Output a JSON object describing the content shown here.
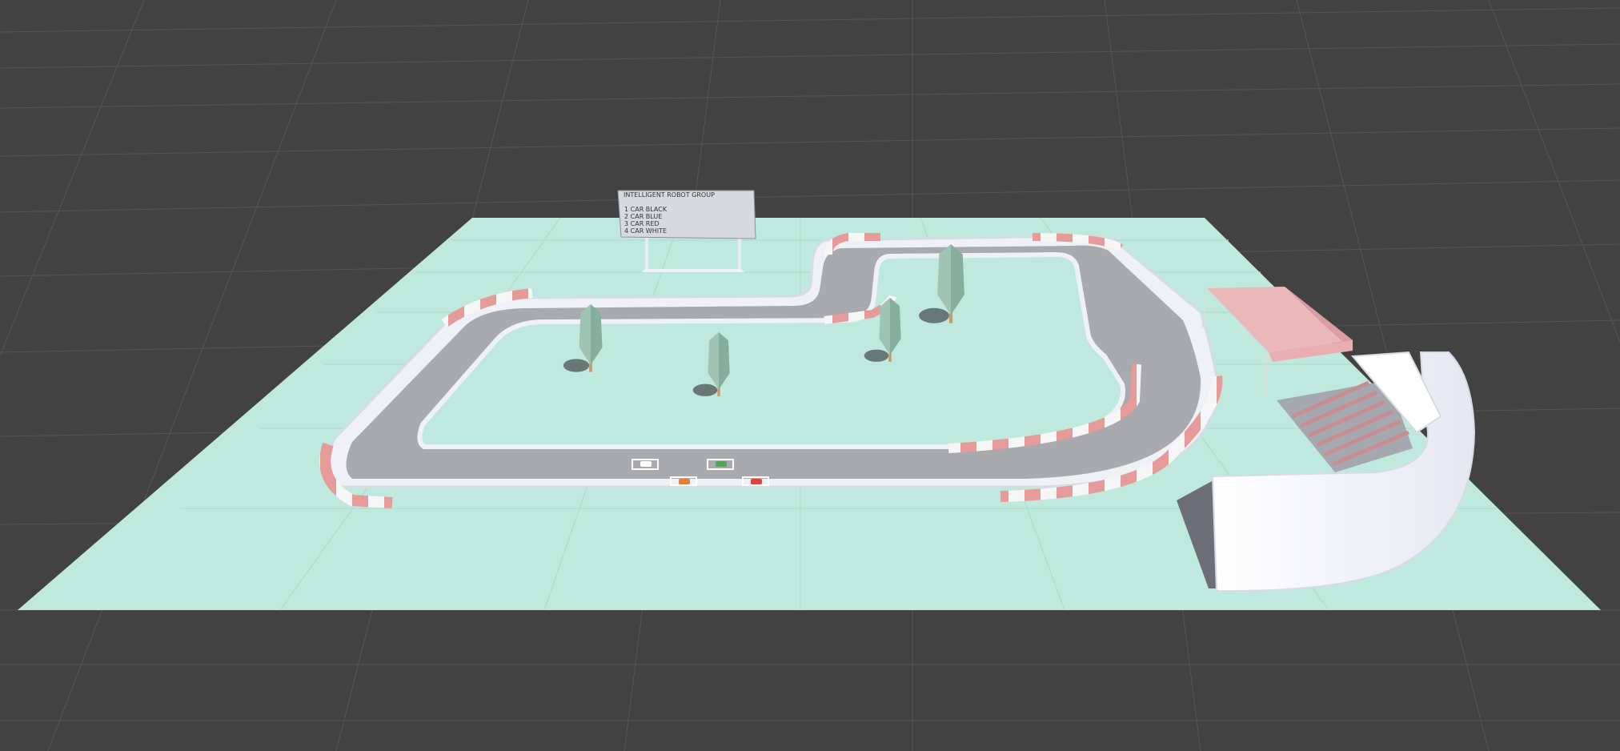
{
  "scene": {
    "background_color": "#424242",
    "grid_color": "#585858",
    "ground_color": "#bfe9dc",
    "ground_grid_color": "#a9d6c8",
    "track_color": "#a9aaae",
    "kerb_red": "#e79a9a",
    "kerb_white": "#f6f6f6",
    "barrier_color": "#e9eef3",
    "tree_color": "#9fc4b3",
    "tent_color": "#eab7ba",
    "grandstand_color": "#eef1f8",
    "seat_color": "#d9a7aa"
  },
  "scoreboard": {
    "title": "INTELLIGENT ROBOT GROUP",
    "lines": [
      "1 CAR BLACK",
      "2 CAR BLUE",
      "3 CAR RED",
      "4 CAR WHITE"
    ]
  },
  "cars": [
    {
      "name": "car-white",
      "color": "#ffffff"
    },
    {
      "name": "car-green",
      "color": "#5aa35a"
    },
    {
      "name": "car-orange",
      "color": "#e0803c"
    },
    {
      "name": "car-red",
      "color": "#d9463f"
    }
  ],
  "trees": [
    {
      "name": "tree-1"
    },
    {
      "name": "tree-2"
    },
    {
      "name": "tree-3"
    },
    {
      "name": "tree-4"
    }
  ]
}
